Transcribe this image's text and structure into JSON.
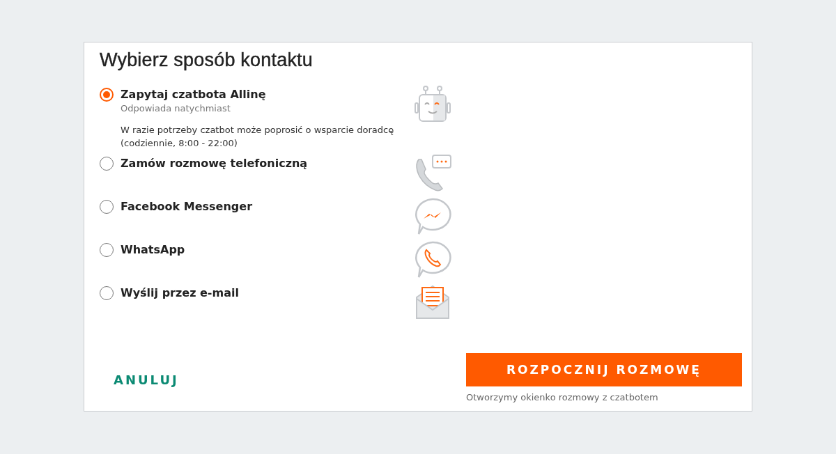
{
  "title": "Wybierz sposób kontaktu",
  "options": [
    {
      "kind": "bot",
      "label": "Zapytaj czatbota Allinę",
      "subtitle": "Odpowiada natychmiast",
      "description": "W razie potrzeby czatbot może poprosić o wsparcie doradcę (codziennie, 8:00 - 22:00)",
      "selected": true
    },
    {
      "kind": "phone",
      "label": "Zamów rozmowę telefoniczną",
      "selected": false
    },
    {
      "kind": "messenger",
      "label": "Facebook Messenger",
      "selected": false
    },
    {
      "kind": "whatsapp",
      "label": "WhatsApp",
      "selected": false
    },
    {
      "kind": "email",
      "label": "Wyślij przez e-mail",
      "selected": false
    }
  ],
  "cancel_button": "ANULUJ",
  "start_button": "ROZPOCZNIJ ROZMOWĘ",
  "start_note": "Otworzymy okienko rozmowy z czatbotem"
}
